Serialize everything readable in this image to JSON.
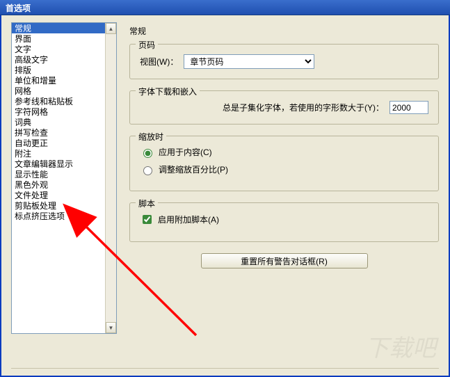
{
  "window": {
    "title": "首选项"
  },
  "sidebar": {
    "selected_index": 0,
    "items": [
      "常规",
      "界面",
      "文字",
      "高级文字",
      "排版",
      "单位和增量",
      "网格",
      "参考线和粘贴板",
      "字符网格",
      "词典",
      "拼写检查",
      "自动更正",
      "附注",
      "文章编辑器显示",
      "显示性能",
      "黑色外观",
      "文件处理",
      "剪贴板处理",
      "标点挤压选项"
    ]
  },
  "content": {
    "heading": "常规",
    "page_numbers": {
      "legend": "页码",
      "view_label": "视图(W)：",
      "view_value": "章节页码"
    },
    "fonts": {
      "legend": "字体下载和嵌入",
      "subset_label": "总是子集化字体，若使用的字形数大于(Y)：",
      "subset_value": "2000"
    },
    "scaling": {
      "legend": "缩放时",
      "apply_to_content": "应用于内容(C)",
      "adjust_percent": "调整缩放百分比(P)",
      "selected": "content"
    },
    "scripts": {
      "legend": "脚本",
      "enable_attached": "启用附加脚本(A)",
      "enabled": true
    },
    "reset_button": "重置所有警告对话框(R)"
  },
  "watermark": "下载吧"
}
